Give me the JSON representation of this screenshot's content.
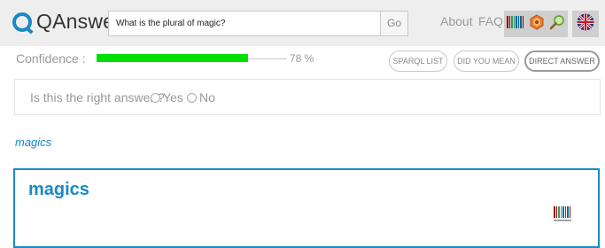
{
  "header": {
    "logo_text": "QAnswer",
    "search": {
      "value": "What is the plural of magic?"
    },
    "go_label": "Go",
    "nav": {
      "about": "About",
      "faq": "FAQ"
    }
  },
  "confidence": {
    "label": "Confidence :",
    "percent_text": "78 %",
    "value": 0.78,
    "bar_color": "#00e000"
  },
  "actions": {
    "sparql_list": "SPARQL LIST",
    "did_you_mean": "DID YOU MEAN",
    "direct_answer": "DIRECT ANSWER"
  },
  "feedback": {
    "question": "Is this the right answer ?",
    "yes": "Yes",
    "no": "No"
  },
  "answer": {
    "link_text": "magics",
    "card_title": "magics"
  },
  "colors": {
    "accent": "#1a88c9",
    "header_bg": "#eeeeee"
  },
  "icons": [
    "wikidata-icon",
    "dbpedia-icon",
    "search-tool-icon",
    "uk-flag-icon"
  ]
}
